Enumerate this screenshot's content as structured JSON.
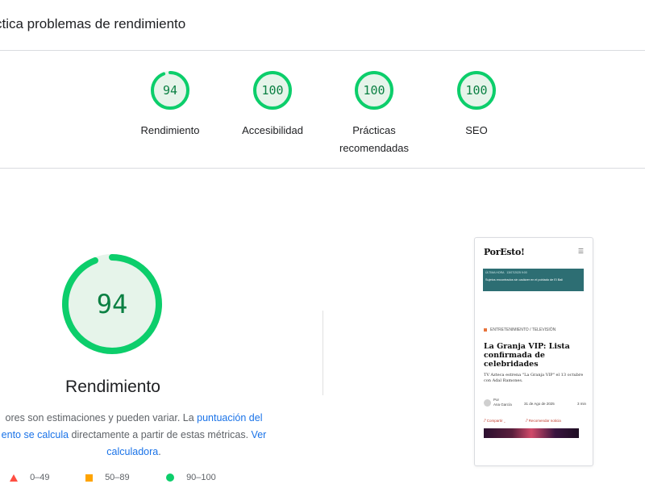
{
  "header": {
    "title": "ctica problemas de rendimiento"
  },
  "scores": [
    {
      "value": "94",
      "label": "Rendimiento",
      "score": 94
    },
    {
      "value": "100",
      "label": "Accesibilidad",
      "score": 100
    },
    {
      "value": "100",
      "label_line1": "Prácticas",
      "label_line2": "recomendadas",
      "score": 100
    },
    {
      "value": "100",
      "label": "SEO",
      "score": 100
    }
  ],
  "main_gauge": {
    "value": "94",
    "score": 94,
    "title": "Rendimiento"
  },
  "description": {
    "text1": "ores son estimaciones y pueden variar. La ",
    "link1_line1": "puntuación del",
    "link1_line2": "ento se calcula",
    "text2": " directamente a partir de estas métricas. ",
    "link2_word1": "Ver",
    "link2_word2": "calculadora",
    "text3": "."
  },
  "legend": [
    {
      "range": "0–49",
      "color": "#ff4e42",
      "shape": "triangle"
    },
    {
      "range": "50–89",
      "color": "#ffa400",
      "shape": "square"
    },
    {
      "range": "90–100",
      "color": "#0cce6b",
      "shape": "circle"
    }
  ],
  "colors": {
    "pass": "#0cce6b",
    "pass_text": "#0b8043",
    "track": "#e6f4ea",
    "link": "#1a73e8"
  },
  "preview": {
    "logo": "PorEsto!",
    "menu_icon": "menu-icon",
    "banner_label": "ÚLTIMA HORA",
    "banner_time": "13/07/2025 9:00",
    "banner_text": "Sujetos encontrados sin cadáver en el poblado de El Bali",
    "category": "ENTRETENIMIENTO / TELEVISIÓN",
    "headline": "La Granja VIP: Lista confirmada de celebridades",
    "subhead": "TV Azteca estrena \"La Granja VIP\" el 13 octubre con Adal Ramones.",
    "author_label": "Por",
    "author_name": "Ana García",
    "date": "31 de Ago de 2025",
    "read_time": "3 min",
    "share": "⤤ Compartir ⌄",
    "recommend": "⤤ Recomendar noticia"
  }
}
